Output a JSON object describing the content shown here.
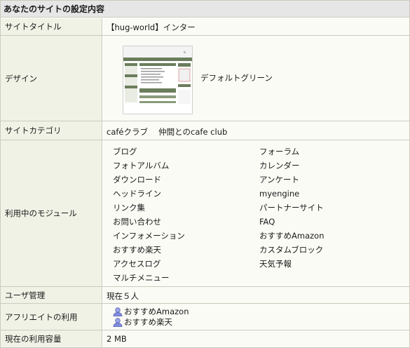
{
  "heading": "あなたのサイトの設定内容",
  "site_title": {
    "label": "サイトタイトル",
    "value": "【hug-world】インター"
  },
  "design": {
    "label": "デザイン",
    "name": "デフォルトグリーン"
  },
  "category": {
    "label": "サイトカテゴリ",
    "value": "caféクラブ　 仲間とのcafe club"
  },
  "modules": {
    "label": "利用中のモジュール",
    "left": [
      "ブログ",
      "フォトアルバム",
      "ダウンロード",
      "ヘッドライン",
      "リンク集",
      "お問い合わせ",
      "インフォメーション",
      "おすすめ楽天",
      "アクセスログ",
      "マルチメニュー"
    ],
    "right": [
      "フォーラム",
      "カレンダー",
      "アンケート",
      "myengine",
      "パートナーサイト",
      "FAQ",
      "おすすめAmazon",
      "カスタムブロック",
      "天気予報"
    ]
  },
  "users": {
    "label": "ユーザ管理",
    "value": "現在５人"
  },
  "affiliate": {
    "label": "アフリエイトの利用",
    "items": [
      "おすすめAmazon",
      "おすすめ楽天"
    ],
    "icon": "user-icon"
  },
  "capacity": {
    "label": "現在の利用容量",
    "value": "2 MB"
  },
  "colors": {
    "label_bg": "#f1f2e6",
    "value_bg": "#fbfbf6",
    "border": "#c9ccbd",
    "heading_bg": "#e6e6e6",
    "thumb_accent": "#6b7d5c"
  }
}
